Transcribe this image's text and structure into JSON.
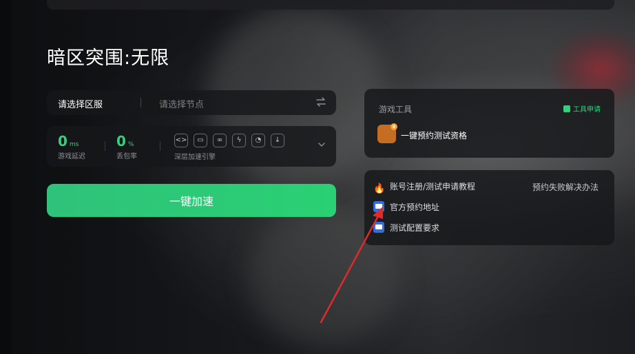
{
  "game": {
    "title": "暗区突围:无限"
  },
  "server_select": {
    "label": "请选择区服",
    "node_placeholder": "请选择节点"
  },
  "stats": {
    "latency_value": "0",
    "latency_unit": "ms",
    "latency_label": "游戏延迟",
    "loss_value": "0",
    "loss_unit": "%",
    "loss_label": "丢包率",
    "engine_label": "深层加速引擎",
    "engine_icons": [
      "link-icon",
      "image-icon",
      "chain-icon",
      "bolt-icon",
      "timer-icon",
      "download-icon"
    ]
  },
  "accelerate": {
    "label": "一键加速"
  },
  "tools": {
    "title": "游戏工具",
    "apply_label": "工具申请",
    "item_label": "一键预约测试资格"
  },
  "links": {
    "tutorial": "账号注册/测试申请教程",
    "fail_fix": "预约失败解决办法",
    "official": "官方预约地址",
    "config": "测试配置要求"
  },
  "colors": {
    "accent": "#33d17a",
    "button": "#2ac876",
    "annotation_arrow": "#e02b2b"
  }
}
